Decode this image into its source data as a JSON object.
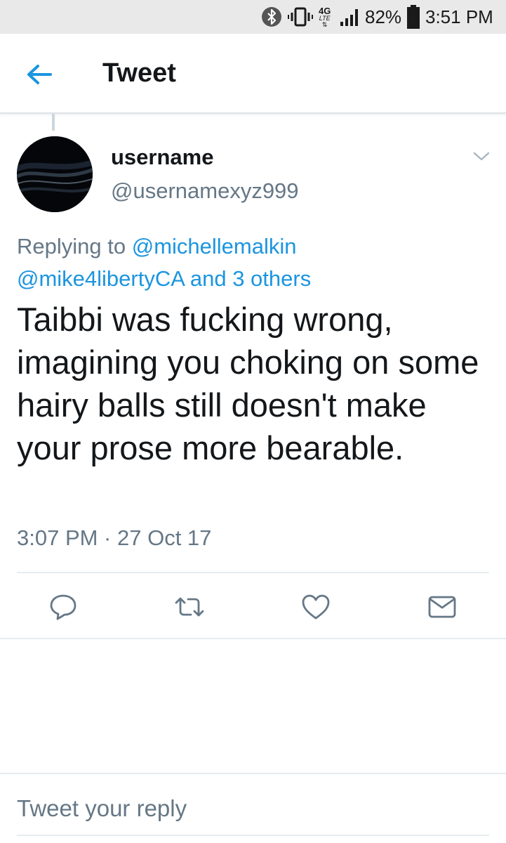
{
  "status_bar": {
    "battery": "82%",
    "time": "3:51 PM",
    "network": "4G",
    "network_sub": "LTE",
    "icons": [
      "bluetooth-icon",
      "vibrate-icon",
      "network-icon",
      "signal-icon",
      "battery-icon"
    ]
  },
  "app_bar": {
    "title": "Tweet",
    "back_icon": "arrow-left-icon"
  },
  "tweet": {
    "display_name": "username",
    "handle": "@usernamexyz999",
    "replying_prefix": "Replying to",
    "replying_to_1": "@michellemalkin",
    "replying_to_2": "@mike4libertyCA",
    "replying_and": "and",
    "replying_others": "3 others",
    "text": "Taibbi was fucking wrong, imagining you choking on some hairy balls still doesn't make your prose more bearable.",
    "timestamp": "3:07 PM · 27 Oct 17"
  },
  "actions": [
    "reply-icon",
    "retweet-icon",
    "like-icon",
    "message-icon"
  ],
  "reply_box": {
    "placeholder": "Tweet your reply"
  },
  "colors": {
    "accent": "#1b95e0",
    "secondary_text": "#657786",
    "primary_text": "#14171a",
    "status_bar_bg": "#e9e9ea"
  }
}
